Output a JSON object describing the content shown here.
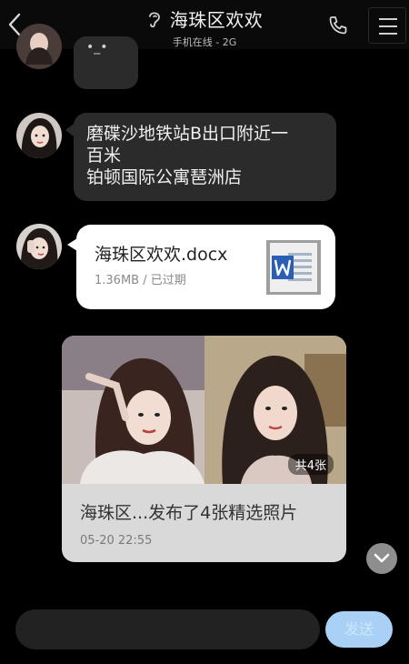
{
  "header": {
    "title": "海珠区欢欢",
    "subtitle": "手机在线 - 2G"
  },
  "messages": {
    "partial_text": "•_•",
    "location_text_1": "磨碟沙地铁站B出口附近一",
    "location_text_2": "百米",
    "location_text_3": "铂顿国际公寓琶洲店",
    "file": {
      "name": "海珠区欢欢.docx",
      "meta": "1.36MB / 已过期",
      "icon": "word-doc-icon"
    },
    "photo_post": {
      "count": "共4张",
      "caption": "海珠区...发布了4张精选照片",
      "time": "05-20 22:55"
    }
  },
  "input": {
    "placeholder": "",
    "send_label": "发送"
  },
  "colors": {
    "background": "#000000",
    "bubble": "#2b2b2b",
    "send_button": "#a9d1f6"
  }
}
